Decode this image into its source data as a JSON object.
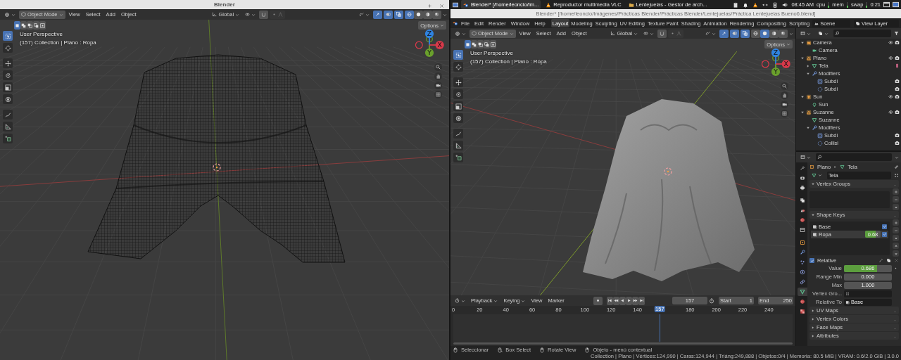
{
  "left_window": {
    "title": "Blender",
    "viewport": {
      "mode": "Object Mode",
      "menus": [
        "View",
        "Select",
        "Add",
        "Object"
      ],
      "orientation": "Global",
      "xray": true,
      "shading": [
        {
          "kind": "wireframe",
          "selected": true
        },
        {
          "kind": "solid",
          "selected": false
        },
        {
          "kind": "material",
          "selected": false
        },
        {
          "kind": "rendered",
          "selected": false
        }
      ],
      "select_modes": [
        {
          "kind": "new",
          "selected": true
        },
        {
          "kind": "extend",
          "selected": false
        },
        {
          "kind": "subtract",
          "selected": false
        },
        {
          "kind": "invert",
          "selected": false
        },
        {
          "kind": "intersect",
          "selected": false
        }
      ],
      "options": "Options",
      "view_name": "User Perspective",
      "context": "(157) Collection | Plano : Ropa",
      "tools": [
        {
          "kind": "select",
          "selected": true
        },
        {
          "kind": "cursor",
          "selected": false
        },
        {
          "kind": "move",
          "selected": false
        },
        {
          "kind": "rotate",
          "selected": false
        },
        {
          "kind": "scale",
          "selected": false
        },
        {
          "kind": "transform",
          "selected": false
        },
        {
          "kind": "annotate",
          "selected": false
        },
        {
          "kind": "measure",
          "selected": false
        },
        {
          "kind": "addcube",
          "selected": false
        }
      ],
      "gizmo": [
        "Z",
        "Y",
        "X"
      ],
      "snap": false,
      "proportional_edit": false,
      "object": {
        "kind": "wireframe"
      }
    }
  },
  "taskbar": {
    "items": [
      {
        "kind": "blender",
        "label": "Blender* [/home/leoncio/Im...",
        "selected": true
      },
      {
        "kind": "vlc",
        "label": "Reproductor multimedia VLC",
        "selected": false
      },
      {
        "kind": "folder",
        "label": "Lentejuelas - Gestor de arch...",
        "selected": false
      }
    ],
    "clock": "08:45 AM",
    "monitors": [
      "cpu",
      "mem",
      "swap"
    ],
    "uptime": "0:21"
  },
  "right_window": {
    "title": "Blender* [/home/leoncio/Imágenes/Prácticas Blender/Prácticas Blender/Lentejuelas/Práctica Lentejuelas Bueno6.blend]",
    "menus": [
      "File",
      "Edit",
      "Render",
      "Window",
      "Help"
    ],
    "workspaces": [
      {
        "label": "Layout",
        "selected": true
      },
      {
        "label": "Modeling",
        "selected": false
      },
      {
        "label": "Sculpting",
        "selected": false
      },
      {
        "label": "UV Editing",
        "selected": false
      },
      {
        "label": "Texture Paint",
        "selected": false
      },
      {
        "label": "Shading",
        "selected": false
      },
      {
        "label": "Animation",
        "selected": false
      },
      {
        "label": "Rendering",
        "selected": false
      },
      {
        "label": "Compositing",
        "selected": false
      },
      {
        "label": "Scripting",
        "selected": false
      }
    ],
    "scene": "Scene",
    "view_layer": "View Layer",
    "viewport": {
      "mode": "Object Mode",
      "menus": [
        "View",
        "Select",
        "Add",
        "Object"
      ],
      "orientation": "Global",
      "xray": true,
      "shading": [
        {
          "kind": "wireframe",
          "selected": false
        },
        {
          "kind": "solid",
          "selected": true
        },
        {
          "kind": "material",
          "selected": false
        },
        {
          "kind": "rendered",
          "selected": false
        }
      ],
      "select_modes": [
        {
          "kind": "new",
          "selected": true
        },
        {
          "kind": "extend",
          "selected": false
        },
        {
          "kind": "subtract",
          "selected": false
        },
        {
          "kind": "invert",
          "selected": false
        },
        {
          "kind": "intersect",
          "selected": false
        }
      ],
      "options": "Options",
      "view_name": "User Perspective",
      "context": "(157) Collection | Plano : Ropa",
      "tools": [
        {
          "kind": "select",
          "selected": true
        },
        {
          "kind": "cursor",
          "selected": false
        },
        {
          "kind": "move",
          "selected": false
        },
        {
          "kind": "rotate",
          "selected": false
        },
        {
          "kind": "scale",
          "selected": false
        },
        {
          "kind": "transform",
          "selected": false
        },
        {
          "kind": "annotate",
          "selected": false
        },
        {
          "kind": "measure",
          "selected": false
        },
        {
          "kind": "addcube",
          "selected": false
        }
      ],
      "gizmo": [
        "Z",
        "Y",
        "X"
      ],
      "snap": false,
      "proportional_edit": false,
      "object": {
        "kind": "solid"
      }
    },
    "outliner": {
      "tree": [
        {
          "label": "Camera",
          "kind": "obj-camera",
          "expanded": true,
          "children": [
            {
              "label": "Camera",
              "kind": "data-camera"
            }
          ]
        },
        {
          "label": "Plano",
          "kind": "obj-mesh",
          "expanded": true,
          "children": [
            {
              "label": "Tela",
              "kind": "data-mesh",
              "expanded": false
            },
            {
              "label": "Modifiers",
              "kind": "modifiers",
              "expanded": true,
              "children": [
                {
                  "label": "Subdi",
                  "kind": "mod-subsurf"
                },
                {
                  "label": "Subdi",
                  "kind": "mod-collision"
                }
              ]
            }
          ]
        },
        {
          "label": "Sun",
          "kind": "obj-light",
          "expanded": true,
          "children": [
            {
              "label": "Sun",
              "kind": "data-light"
            }
          ]
        },
        {
          "label": "Suzanne",
          "kind": "obj-mesh",
          "expanded": true,
          "children": [
            {
              "label": "Suzanne",
              "kind": "data-mesh"
            },
            {
              "label": "Modifiers",
              "kind": "modifiers",
              "expanded": true,
              "children": [
                {
                  "label": "Subdi",
                  "kind": "mod-subsurf"
                },
                {
                  "label": "Collisi",
                  "kind": "mod-collision"
                }
              ]
            }
          ]
        }
      ]
    },
    "properties": {
      "tabs": [
        {
          "kind": "tool",
          "selected": false
        },
        {
          "kind": "render",
          "selected": false
        },
        {
          "kind": "output",
          "selected": false
        },
        {
          "kind": "viewlayer",
          "selected": false
        },
        {
          "kind": "scene",
          "selected": false
        },
        {
          "kind": "world",
          "selected": false
        },
        {
          "kind": "collection",
          "selected": false
        },
        {
          "kind": "object",
          "selected": false
        },
        {
          "kind": "modifiers",
          "selected": false
        },
        {
          "kind": "particles",
          "selected": false
        },
        {
          "kind": "physics",
          "selected": false
        },
        {
          "kind": "constraints",
          "selected": false
        },
        {
          "kind": "data",
          "selected": true
        },
        {
          "kind": "material",
          "selected": false
        },
        {
          "kind": "texture",
          "selected": false
        }
      ],
      "breadcrumb": [
        "Plano",
        "Tela"
      ],
      "data_name": "Tela",
      "panels": [
        {
          "kind": "list",
          "title": "Vertex Groups",
          "expanded": true
        },
        {
          "kind": "shape_keys",
          "title": "Shape Keys",
          "expanded": true,
          "keys": [
            {
              "name": "Base",
              "selected": false,
              "checked": true
            },
            {
              "name": "Ropa",
              "value": "0.68",
              "level": 0.686,
              "selected": true,
              "checked": true
            }
          ],
          "relative": {
            "label": "Relative",
            "checked": true
          },
          "fields": [
            {
              "kind": "slider",
              "label": "Value",
              "value": "0.686",
              "level": 0.686
            },
            {
              "kind": "number",
              "label": "Range Min",
              "value": "0.000"
            },
            {
              "kind": "number",
              "label": "Max",
              "value": "1.000"
            },
            {
              "kind": "search",
              "label": "Vertex Gro..."
            },
            {
              "kind": "select",
              "label": "Relative To",
              "value": "Base"
            }
          ]
        },
        {
          "kind": "list",
          "title": "UV Maps",
          "expanded": false
        },
        {
          "kind": "list",
          "title": "Vertex Colors",
          "expanded": false
        },
        {
          "kind": "list",
          "title": "Face Maps",
          "expanded": false
        },
        {
          "kind": "list",
          "title": "Attributes",
          "expanded": false
        }
      ]
    },
    "timeline": {
      "menus": [
        "Playback",
        "Keying",
        "View",
        "Marker"
      ],
      "current_frame": "157",
      "start": {
        "label": "Start",
        "value": "1"
      },
      "end": {
        "label": "End",
        "value": "250"
      },
      "ticks": [
        "0",
        "20",
        "40",
        "60",
        "80",
        "100",
        "120",
        "140",
        "180",
        "200",
        "220",
        "240"
      ],
      "playhead": {
        "label": "157",
        "level": 0.6085
      }
    },
    "status_bar": {
      "hints": [
        {
          "kind": "mouse-left",
          "label": "Seleccionar"
        },
        {
          "kind": "mouse-drag",
          "label": "Box Select"
        },
        {
          "kind": "mouse-middle",
          "label": "Rotate View"
        },
        {
          "kind": "mouse-right",
          "label": "Objeto - menú contextual"
        }
      ],
      "stats": "Collection | Plano | Vértices:124,990 | Caras:124,944 | Triáng:249,888 | Objetos:0/4 | Memoria: 80.5 MiB | VRAM: 0.6/2.0 GiB | 3.0.0"
    }
  }
}
